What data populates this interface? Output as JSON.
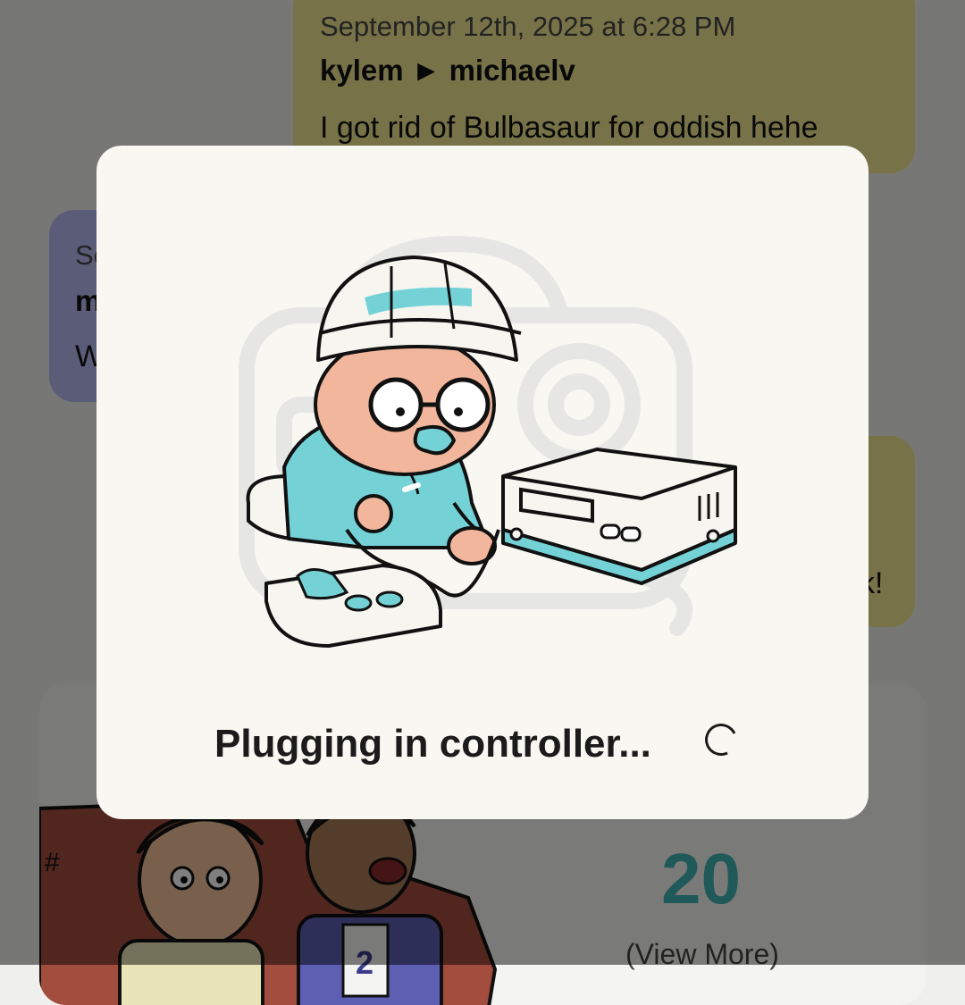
{
  "messages": [
    {
      "date": "September 12th, 2025 at 6:28 PM",
      "users": "kylem ► michaelv",
      "text": "I got rid of Bulbasaur for oddish hehe"
    },
    {
      "date_fragment": "Se",
      "users_fragment": "m",
      "text_fragment": "W"
    },
    {
      "text_fragment": "k!"
    }
  ],
  "card": {
    "count": "20",
    "view_more": "(View More)"
  },
  "dialog": {
    "loading_text": "Plugging in controller..."
  },
  "colors": {
    "yellow_bubble": "#f0e591",
    "purple_bubble": "#b6b8f0",
    "accent_teal": "#3fb3b3",
    "dialog_bg": "#f8f7f2"
  }
}
